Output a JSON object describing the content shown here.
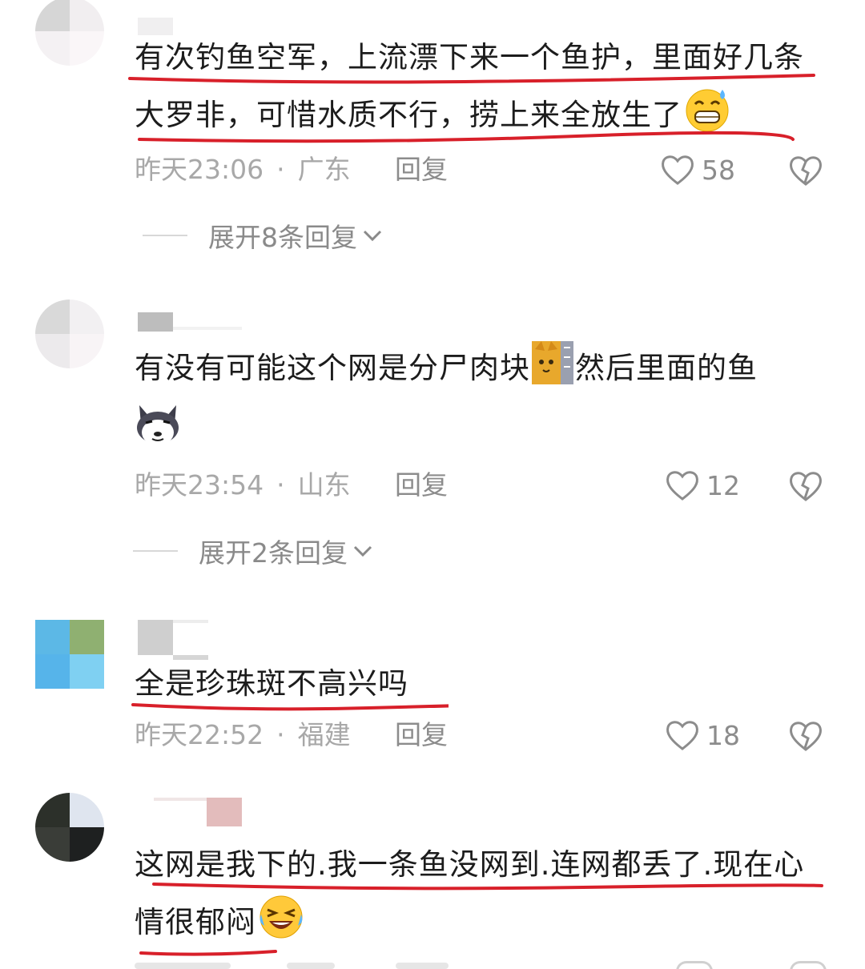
{
  "comments": [
    {
      "text": "有次钓鱼空军，上流漂下来一个鱼护，里面好几条大罗非，可惜水质不行，捞上来全放生了",
      "emoji": "sweat-grin-emoji",
      "time": "昨天23:06",
      "location": "广东",
      "reply": "回复",
      "likes": "58",
      "expand": "展开8条回复"
    },
    {
      "text": "有没有可能这个网是分尸肉块",
      "text2": "然后里面的鱼",
      "emoji": "cat-emoji",
      "emoji2": "husky-emoji",
      "time": "昨天23:54",
      "location": "山东",
      "reply": "回复",
      "likes": "12",
      "expand": "展开2条回复"
    },
    {
      "text": "全是珍珠斑不高兴吗",
      "time": "昨天22:52",
      "location": "福建",
      "reply": "回复",
      "likes": "18"
    },
    {
      "text": "这网是我下的.我一条鱼没网到.连网都丢了.现在心情很郁闷",
      "emoji": "laughing-crying-emoji"
    }
  ],
  "colors": {
    "underline": "#d8202a",
    "meta": "#a8a8a8",
    "text": "#1c1c1c"
  }
}
